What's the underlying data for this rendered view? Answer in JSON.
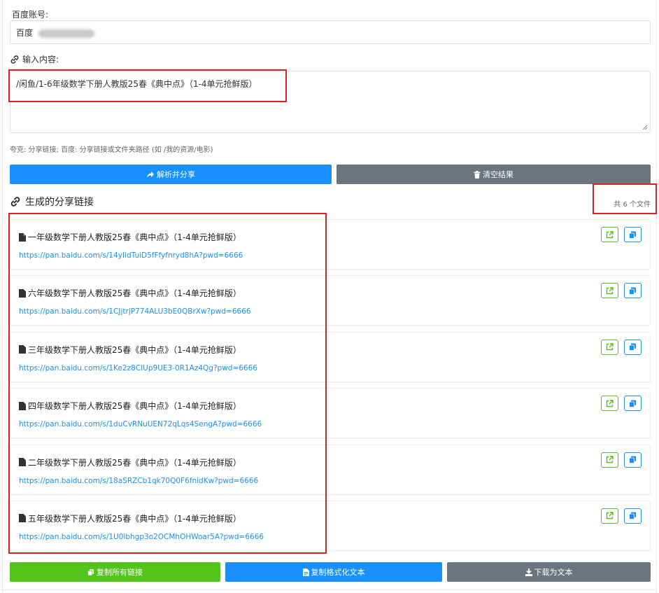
{
  "account": {
    "label": "百度账号:",
    "value_prefix": "百度"
  },
  "input": {
    "label": "输入内容:",
    "value": "/闲鱼/1-6年级数学下册人教版25春《典中点》（1-4单元抢鲜版）",
    "hint": "夸克: 分享链接; 百度: 分享链接或文件夹路径 (如 /我的资源/电影)"
  },
  "actions": {
    "parse_label": "解析并分享",
    "clear_label": "清空结果"
  },
  "results": {
    "title": "生成的分享链接",
    "count_text": "共 6 个文件",
    "items": [
      {
        "name": "一年级数学下册人教版25春《典中点》（1-4单元抢鲜版）",
        "url": "https://pan.baidu.com/s/14yIidTuiD5fFfyfnryd8hA?pwd=6666"
      },
      {
        "name": "六年级数学下册人教版25春《典中点》（1-4单元抢鲜版）",
        "url": "https://pan.baidu.com/s/1CJjtrjP774ALU3bE0QBrXw?pwd=6666"
      },
      {
        "name": "三年级数学下册人教版25春《典中点》（1-4单元抢鲜版）",
        "url": "https://pan.baidu.com/s/1Ke2z8CIUp9UE3-0R1Az4Qg?pwd=6666"
      },
      {
        "name": "四年级数学下册人教版25春《典中点》（1-4单元抢鲜版）",
        "url": "https://pan.baidu.com/s/1duCvRNuUEN72qLqs4SengA?pwd=6666"
      },
      {
        "name": "二年级数学下册人教版25春《典中点》（1-4单元抢鲜版）",
        "url": "https://pan.baidu.com/s/18aSRZCb1qk70Q0F6fnidKw?pwd=6666"
      },
      {
        "name": "五年级数学下册人教版25春《典中点》（1-4单元抢鲜版）",
        "url": "https://pan.baidu.com/s/1U0lbhgp3o2OCMhOHWoar5A?pwd=6666"
      }
    ]
  },
  "footer": {
    "copy_all_label": "复制所有链接",
    "copy_formatted_label": "复制格式化文本",
    "download_label": "下载为文本"
  },
  "colors": {
    "primary": "#1890ff",
    "success": "#52c41a",
    "secondary": "#6c757d",
    "highlight": "#e02020"
  }
}
